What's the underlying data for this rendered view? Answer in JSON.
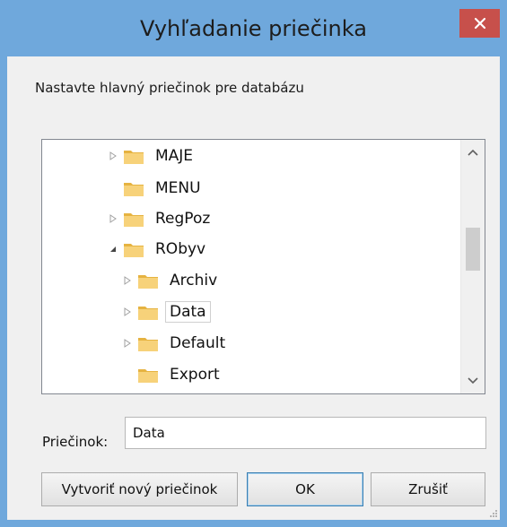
{
  "window": {
    "title": "Vyhľadanie priečinka",
    "close_icon": "close-icon"
  },
  "instruction": "Nastavte hlavný priečinok pre databázu",
  "tree": {
    "items": [
      {
        "label": "MAJE",
        "expander": "collapsed",
        "level": 1
      },
      {
        "label": "MENU",
        "expander": "none",
        "level": 1
      },
      {
        "label": "RegPoz",
        "expander": "collapsed",
        "level": 1
      },
      {
        "label": "RObyv",
        "expander": "expanded",
        "level": 1
      },
      {
        "label": "Archiv",
        "expander": "collapsed",
        "level": 2
      },
      {
        "label": "Data",
        "expander": "collapsed",
        "level": 2,
        "selected": true
      },
      {
        "label": "Default",
        "expander": "collapsed",
        "level": 2
      },
      {
        "label": "Export",
        "expander": "none",
        "level": 2
      }
    ]
  },
  "folder_field": {
    "label": "Priečinok:",
    "value": "Data"
  },
  "buttons": {
    "new_folder": "Vytvoriť nový priečinok",
    "ok": "OK",
    "cancel": "Zrušiť"
  },
  "colors": {
    "titlebar": "#6fa8dc",
    "close": "#c7504b",
    "dialog_bg": "#f0f0f0",
    "folder_yellow": "#f2c55a"
  }
}
